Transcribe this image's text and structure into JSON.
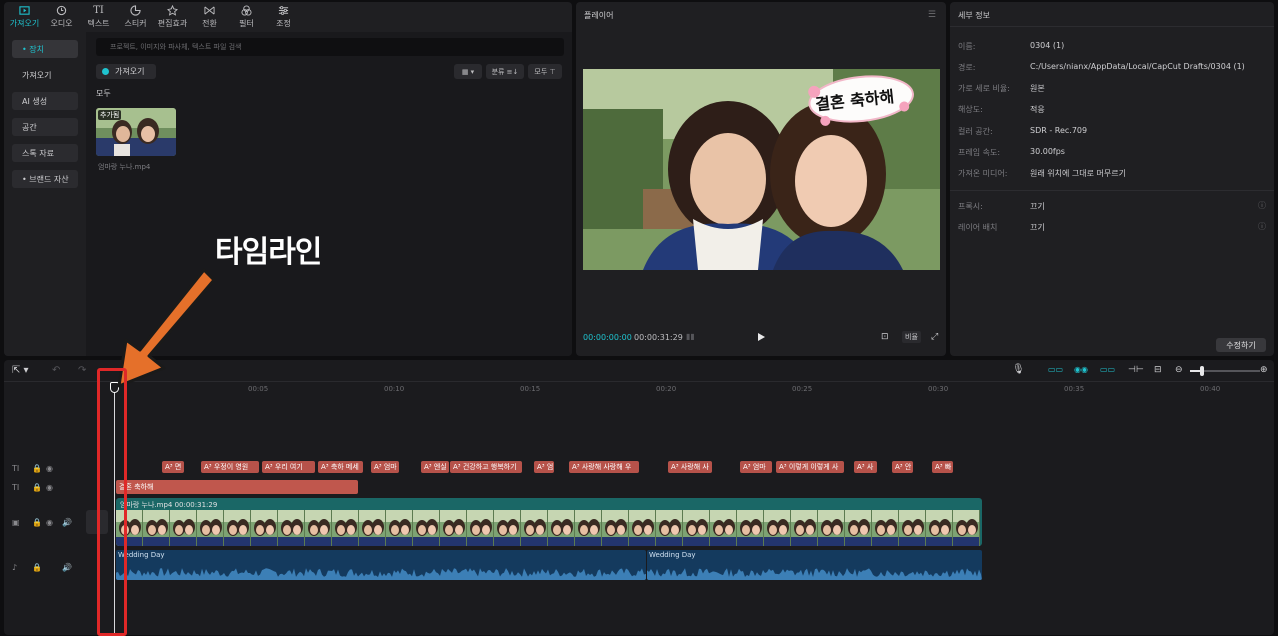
{
  "top_tabs": [
    {
      "label": "가져오기",
      "icon": "import-icon"
    },
    {
      "label": "오디오",
      "icon": "audio-icon"
    },
    {
      "label": "텍스트",
      "icon": "text-icon"
    },
    {
      "label": "스티커",
      "icon": "sticker-icon"
    },
    {
      "label": "편집효과",
      "icon": "effects-icon"
    },
    {
      "label": "전환",
      "icon": "transition-icon"
    },
    {
      "label": "필터",
      "icon": "filter-icon"
    },
    {
      "label": "조정",
      "icon": "adjust-icon"
    }
  ],
  "sidebar": {
    "items": [
      "• 장치",
      "가져오기",
      "AI 생성",
      "공간",
      "스톡 자료",
      "• 브랜드 자산"
    ]
  },
  "media": {
    "search_placeholder": "프로젝트, 이미지와 파사체, 텍스트 파일 검색",
    "import_label": "가져오기",
    "sort_label": "분류 ≡↓",
    "filter_label": "모두 ⊤",
    "all_label": "모두",
    "thumb_tag": "추가됨",
    "thumb_name": "엄마랑 누나.mp4"
  },
  "player": {
    "title": "플레이어",
    "sticker_text": "결혼 축하해",
    "time_current": "00:00:00:00",
    "time_total": "00:00:31:29",
    "ratio_label": "비율"
  },
  "details": {
    "title": "세부 정보",
    "rows": [
      {
        "k": "이름:",
        "v": "0304 (1)"
      },
      {
        "k": "경로:",
        "v": "C:/Users/nianx/AppData/Local/CapCut Drafts/0304 (1)"
      },
      {
        "k": "가로 세로 비율:",
        "v": "원본"
      },
      {
        "k": "해상도:",
        "v": "적응"
      },
      {
        "k": "컬러 공간:",
        "v": "SDR - Rec.709"
      },
      {
        "k": "프레임 속도:",
        "v": "30.00fps"
      },
      {
        "k": "가져온 미디어:",
        "v": "원래 위치에 그대로 머무르기"
      }
    ],
    "rows2": [
      {
        "k": "프록시:",
        "v": "끄기"
      },
      {
        "k": "레이어 배치",
        "v": "끄기"
      }
    ],
    "edit_button": "수정하기"
  },
  "timeline": {
    "ruler": [
      "00:05",
      "00:10",
      "00:15",
      "00:20",
      "00:25",
      "00:30",
      "00:35",
      "00:40"
    ],
    "text_clips": [
      "A³ 면",
      "A³ 우정이 영원",
      "A³ 우리 여기",
      "A³ 축하 메세",
      "A³ 엄마",
      "A³ 엔실",
      "A³ 건강하고 행복하기",
      "A³ 엄",
      "A³ 사랑해 사랑해 우",
      "A³ 사랑해 사",
      "A³ 엄마",
      "A³ 이렇게 이렇게 사",
      "A³ 사",
      "A³ 안",
      "A³ 빠"
    ],
    "sticker_clip": "결혼 축하해",
    "video_clip": "엄마랑 누나.mp4  00:00:31:29",
    "audio_clip_1": "Wedding Day",
    "audio_clip_2": "Wedding Day"
  },
  "annotation": {
    "label": "타임라인"
  },
  "colors": {
    "accent": "#1fc3cf",
    "annotation_red": "#e02828",
    "annotation_arrow": "#e5702a"
  }
}
